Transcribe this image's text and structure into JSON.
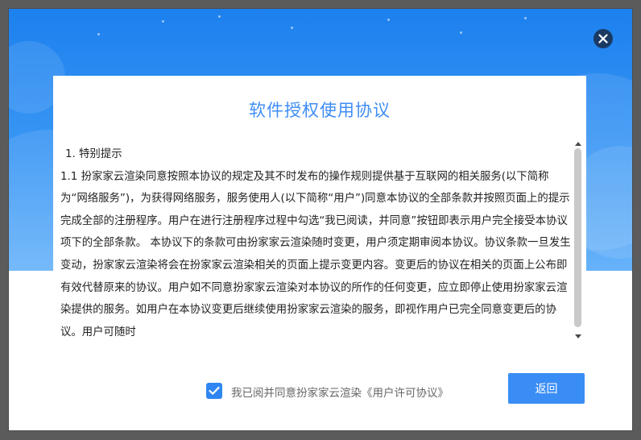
{
  "dialog": {
    "close_icon": "close-icon",
    "title": "软件授权使用协议",
    "paragraphs": [
      "1. 特别提示",
      "1.1 扮家家云渲染同意按照本协议的规定及其不时发布的操作规则提供基于互联网的相关服务(以下简称为“网络服务”)，为获得网络服务，服务使用人(以下简称“用户”)同意本协议的全部条款并按照页面上的提示完成全部的注册程序。用户在进行注册程序过程中勾选“我已阅读，并同意”按钮即表示用户完全接受本协议项下的全部条款。 本协议下的条款可由扮家家云渲染随时变更，用户须定期审阅本协议。协议条款一旦发生变动，扮家家云渲染将会在扮家家云渲染相关的页面上提示变更内容。变更后的协议在相关的页面上公布即有效代替原来的协议。用户如不同意扮家家云渲染对本协议的所作的任何变更，应立即停止使用扮家家云渲染提供的服务。如用户在本协议变更后继续使用扮家家云渲染的服务，即视作用户已完全同意变更后的协议。用户可随时"
    ],
    "agree_checked": true,
    "agree_label": "我已阅并同意扮家家云渲染《用户许可协议》",
    "return_label": "返回",
    "accent_color": "#3a8df5"
  }
}
